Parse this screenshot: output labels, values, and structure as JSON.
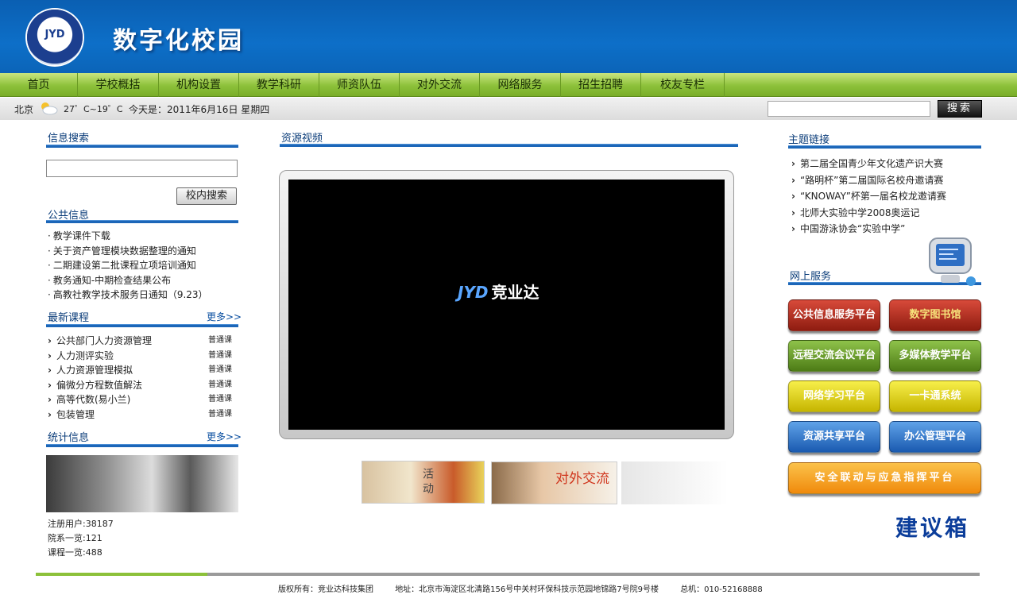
{
  "header": {
    "title": "数字化校园",
    "logo_text": "JYD"
  },
  "nav": [
    "首页",
    "学校概括",
    "机构设置",
    "教学科研",
    "师资队伍",
    "对外交流",
    "网络服务",
    "招生招聘",
    "校友专栏"
  ],
  "infobar": {
    "city": "北京",
    "temp": "27゜C~19゜C",
    "date": "今天是：2011年6月16日 星期四",
    "search_button": "搜索"
  },
  "left": {
    "info_search_title": "信息搜索",
    "school_search_button": "校内搜索",
    "public_info_title": "公共信息",
    "public_info": [
      "教学课件下载",
      "关于资产管理模块数据整理的通知",
      "二期建设第二批课程立项培训通知",
      "教务通知-中期检查结果公布",
      "高教社教学技术服务日通知（9.23）"
    ],
    "courses_title": "最新课程",
    "more": "更多>>",
    "courses": [
      {
        "name": "公共部门人力资源管理",
        "tag": "普通课"
      },
      {
        "name": "人力测评实验",
        "tag": "普通课"
      },
      {
        "name": "人力资源管理模拟",
        "tag": "普通课"
      },
      {
        "name": "偏微分方程数值解法",
        "tag": "普通课"
      },
      {
        "name": "高等代数(易小兰)",
        "tag": "普通课"
      },
      {
        "name": "包装管理",
        "tag": "普通课"
      }
    ],
    "stats_title": "统计信息",
    "stats": {
      "users": "注册用户:38187",
      "depts": "院系一览:121",
      "courses": "课程一览:488"
    }
  },
  "center": {
    "title": "资源视频",
    "video_logo": "JYD",
    "video_logo_cn": "竞业达",
    "thumb1_text": "活 动",
    "thumb2_text": "对外交流"
  },
  "right": {
    "links_title": "主题链接",
    "links": [
      "第二届全国青少年文化遗产识大赛",
      "“路明杯”第二届国际名校舟邀请赛",
      "“KNOWAY”杯第一届名校龙邀请赛",
      "北师大实验中学2008奥运记",
      "中国游泳协会“实验中学”"
    ],
    "services_title": "网上服务",
    "services": [
      "公共信息服务平台",
      "数字图书馆",
      "远程交流会议平台",
      "多媒体教学平台",
      "网络学习平台",
      "一卡通系统",
      "资源共享平台",
      "办公管理平台",
      "安全联动与应急指挥平台"
    ],
    "suggest": "建议箱"
  },
  "footer": {
    "copyright": "版权所有：竞业达科技集团",
    "address": "地址：北京市海淀区北清路156号中关村环保科技示范园地锦路7号院9号楼",
    "phone": "总机：010-52168888"
  }
}
